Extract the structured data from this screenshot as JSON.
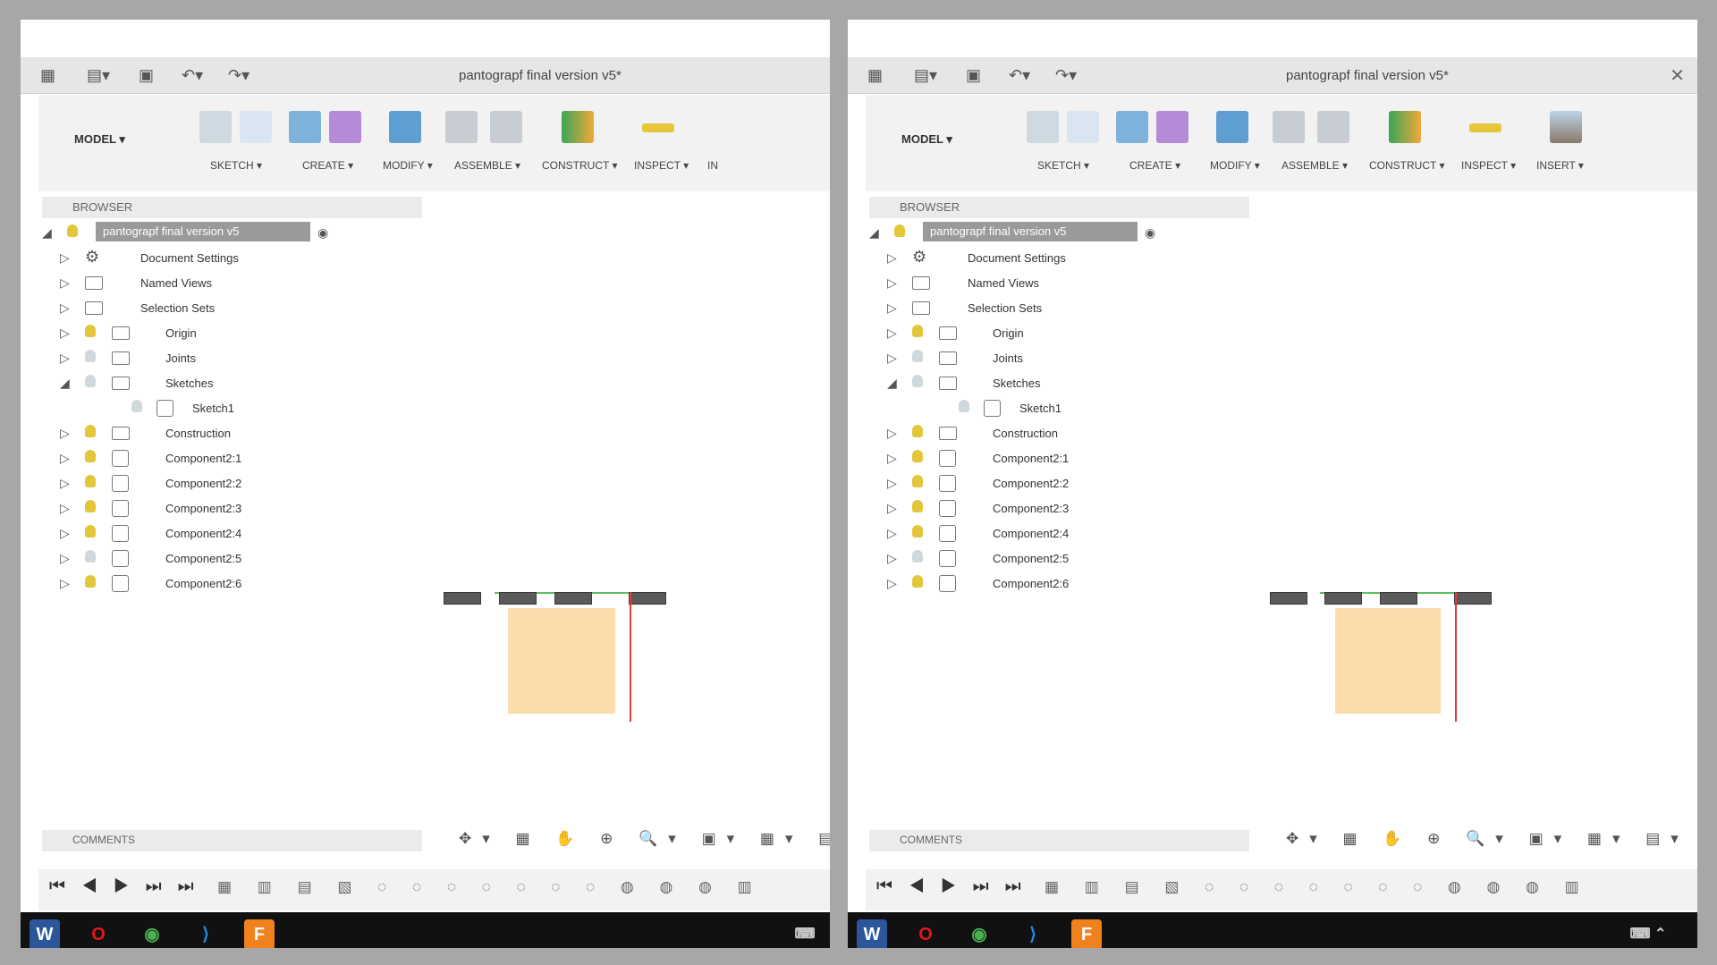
{
  "window": {
    "title": "pantograpf final version v5*",
    "close": "✕"
  },
  "toolbar": {
    "model": "MODEL ▾",
    "groups": [
      "SKETCH ▾",
      "CREATE ▾",
      "MODIFY ▾",
      "ASSEMBLE ▾",
      "CONSTRUCT ▾",
      "INSPECT ▾",
      "INSERT ▾"
    ],
    "left_truncated": "IN"
  },
  "browser": {
    "title": "BROWSER",
    "root": "pantograpf final version v5",
    "items": [
      {
        "label": "Document Settings",
        "type": "settings",
        "expanded": false
      },
      {
        "label": "Named Views",
        "type": "folder",
        "expanded": false
      },
      {
        "label": "Selection Sets",
        "type": "folder",
        "expanded": false
      },
      {
        "label": "Origin",
        "type": "folder",
        "expanded": false,
        "bulb": "on"
      },
      {
        "label": "Joints",
        "type": "folder",
        "expanded": false,
        "bulb": "off"
      },
      {
        "label": "Sketches",
        "type": "folder",
        "expanded": true,
        "bulb": "off"
      },
      {
        "label": "Sketch1",
        "type": "sketch",
        "child": true,
        "bulb": "off"
      },
      {
        "label": "Construction",
        "type": "folder",
        "expanded": false,
        "bulb": "on"
      },
      {
        "label": "Component2:1",
        "type": "component",
        "expanded": false,
        "bulb": "on"
      },
      {
        "label": "Component2:2",
        "type": "component",
        "expanded": false,
        "bulb": "on"
      },
      {
        "label": "Component2:3",
        "type": "component",
        "expanded": false,
        "bulb": "on"
      },
      {
        "label": "Component2:4",
        "type": "component",
        "expanded": false,
        "bulb": "on"
      },
      {
        "label": "Component2:5",
        "type": "component",
        "expanded": false,
        "bulb": "off"
      },
      {
        "label": "Component2:6",
        "type": "component",
        "expanded": false,
        "bulb": "on"
      }
    ]
  },
  "comments": {
    "title": "COMMENTS"
  },
  "navbar": {
    "icons": "✥▾ ▦ ✋ ⊕ 🔍▾ ▣▾ ▦▾ ▤▾"
  },
  "timeline": {
    "controls": "⏮◀▶⏭⏭",
    "features": "▦ ▥ ▤ ▧ ◌ ◌ ◌ ◌ ◌ ◌ ◌ ◍ ◍ ◍ ▥"
  },
  "taskbar": {
    "apps": [
      {
        "name": "Word",
        "glyph": "W",
        "color": "#2b579a"
      },
      {
        "name": "Opera",
        "glyph": "O",
        "color": "#e0181e"
      },
      {
        "name": "Chrome",
        "glyph": "◉",
        "color": "#4caf50"
      },
      {
        "name": "VS Code",
        "glyph": "⟩",
        "color": "#1e88e5"
      },
      {
        "name": "Fusion 360",
        "glyph": "F",
        "color": "#f0821e"
      }
    ],
    "tray_left": "⌨",
    "tray_right": "⌨  ⌃"
  }
}
